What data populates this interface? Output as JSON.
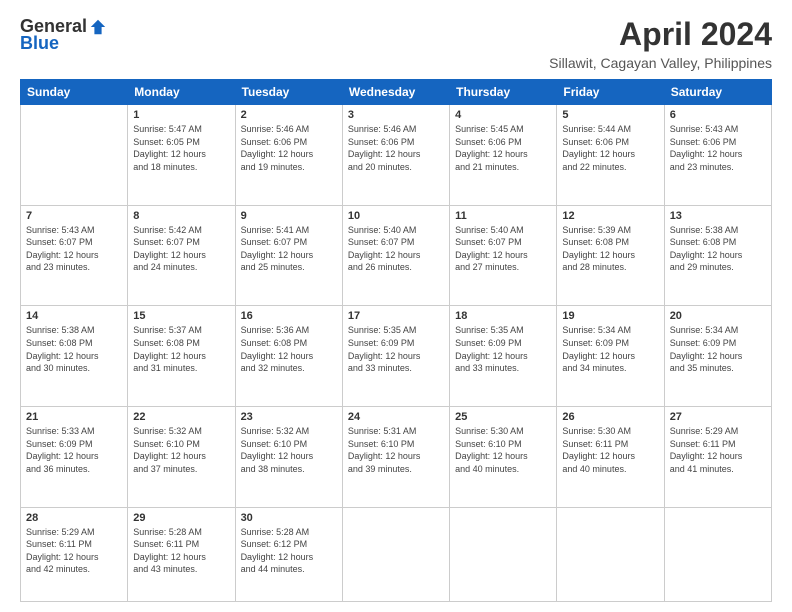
{
  "header": {
    "logo_general": "General",
    "logo_blue": "Blue",
    "title": "April 2024",
    "subtitle": "Sillawit, Cagayan Valley, Philippines"
  },
  "calendar": {
    "days_of_week": [
      "Sunday",
      "Monday",
      "Tuesday",
      "Wednesday",
      "Thursday",
      "Friday",
      "Saturday"
    ],
    "weeks": [
      [
        {
          "day": "",
          "info": ""
        },
        {
          "day": "1",
          "info": "Sunrise: 5:47 AM\nSunset: 6:05 PM\nDaylight: 12 hours\nand 18 minutes."
        },
        {
          "day": "2",
          "info": "Sunrise: 5:46 AM\nSunset: 6:06 PM\nDaylight: 12 hours\nand 19 minutes."
        },
        {
          "day": "3",
          "info": "Sunrise: 5:46 AM\nSunset: 6:06 PM\nDaylight: 12 hours\nand 20 minutes."
        },
        {
          "day": "4",
          "info": "Sunrise: 5:45 AM\nSunset: 6:06 PM\nDaylight: 12 hours\nand 21 minutes."
        },
        {
          "day": "5",
          "info": "Sunrise: 5:44 AM\nSunset: 6:06 PM\nDaylight: 12 hours\nand 22 minutes."
        },
        {
          "day": "6",
          "info": "Sunrise: 5:43 AM\nSunset: 6:06 PM\nDaylight: 12 hours\nand 23 minutes."
        }
      ],
      [
        {
          "day": "7",
          "info": "Sunrise: 5:43 AM\nSunset: 6:07 PM\nDaylight: 12 hours\nand 23 minutes."
        },
        {
          "day": "8",
          "info": "Sunrise: 5:42 AM\nSunset: 6:07 PM\nDaylight: 12 hours\nand 24 minutes."
        },
        {
          "day": "9",
          "info": "Sunrise: 5:41 AM\nSunset: 6:07 PM\nDaylight: 12 hours\nand 25 minutes."
        },
        {
          "day": "10",
          "info": "Sunrise: 5:40 AM\nSunset: 6:07 PM\nDaylight: 12 hours\nand 26 minutes."
        },
        {
          "day": "11",
          "info": "Sunrise: 5:40 AM\nSunset: 6:07 PM\nDaylight: 12 hours\nand 27 minutes."
        },
        {
          "day": "12",
          "info": "Sunrise: 5:39 AM\nSunset: 6:08 PM\nDaylight: 12 hours\nand 28 minutes."
        },
        {
          "day": "13",
          "info": "Sunrise: 5:38 AM\nSunset: 6:08 PM\nDaylight: 12 hours\nand 29 minutes."
        }
      ],
      [
        {
          "day": "14",
          "info": "Sunrise: 5:38 AM\nSunset: 6:08 PM\nDaylight: 12 hours\nand 30 minutes."
        },
        {
          "day": "15",
          "info": "Sunrise: 5:37 AM\nSunset: 6:08 PM\nDaylight: 12 hours\nand 31 minutes."
        },
        {
          "day": "16",
          "info": "Sunrise: 5:36 AM\nSunset: 6:08 PM\nDaylight: 12 hours\nand 32 minutes."
        },
        {
          "day": "17",
          "info": "Sunrise: 5:35 AM\nSunset: 6:09 PM\nDaylight: 12 hours\nand 33 minutes."
        },
        {
          "day": "18",
          "info": "Sunrise: 5:35 AM\nSunset: 6:09 PM\nDaylight: 12 hours\nand 33 minutes."
        },
        {
          "day": "19",
          "info": "Sunrise: 5:34 AM\nSunset: 6:09 PM\nDaylight: 12 hours\nand 34 minutes."
        },
        {
          "day": "20",
          "info": "Sunrise: 5:34 AM\nSunset: 6:09 PM\nDaylight: 12 hours\nand 35 minutes."
        }
      ],
      [
        {
          "day": "21",
          "info": "Sunrise: 5:33 AM\nSunset: 6:09 PM\nDaylight: 12 hours\nand 36 minutes."
        },
        {
          "day": "22",
          "info": "Sunrise: 5:32 AM\nSunset: 6:10 PM\nDaylight: 12 hours\nand 37 minutes."
        },
        {
          "day": "23",
          "info": "Sunrise: 5:32 AM\nSunset: 6:10 PM\nDaylight: 12 hours\nand 38 minutes."
        },
        {
          "day": "24",
          "info": "Sunrise: 5:31 AM\nSunset: 6:10 PM\nDaylight: 12 hours\nand 39 minutes."
        },
        {
          "day": "25",
          "info": "Sunrise: 5:30 AM\nSunset: 6:10 PM\nDaylight: 12 hours\nand 40 minutes."
        },
        {
          "day": "26",
          "info": "Sunrise: 5:30 AM\nSunset: 6:11 PM\nDaylight: 12 hours\nand 40 minutes."
        },
        {
          "day": "27",
          "info": "Sunrise: 5:29 AM\nSunset: 6:11 PM\nDaylight: 12 hours\nand 41 minutes."
        }
      ],
      [
        {
          "day": "28",
          "info": "Sunrise: 5:29 AM\nSunset: 6:11 PM\nDaylight: 12 hours\nand 42 minutes."
        },
        {
          "day": "29",
          "info": "Sunrise: 5:28 AM\nSunset: 6:11 PM\nDaylight: 12 hours\nand 43 minutes."
        },
        {
          "day": "30",
          "info": "Sunrise: 5:28 AM\nSunset: 6:12 PM\nDaylight: 12 hours\nand 44 minutes."
        },
        {
          "day": "",
          "info": ""
        },
        {
          "day": "",
          "info": ""
        },
        {
          "day": "",
          "info": ""
        },
        {
          "day": "",
          "info": ""
        }
      ]
    ]
  }
}
